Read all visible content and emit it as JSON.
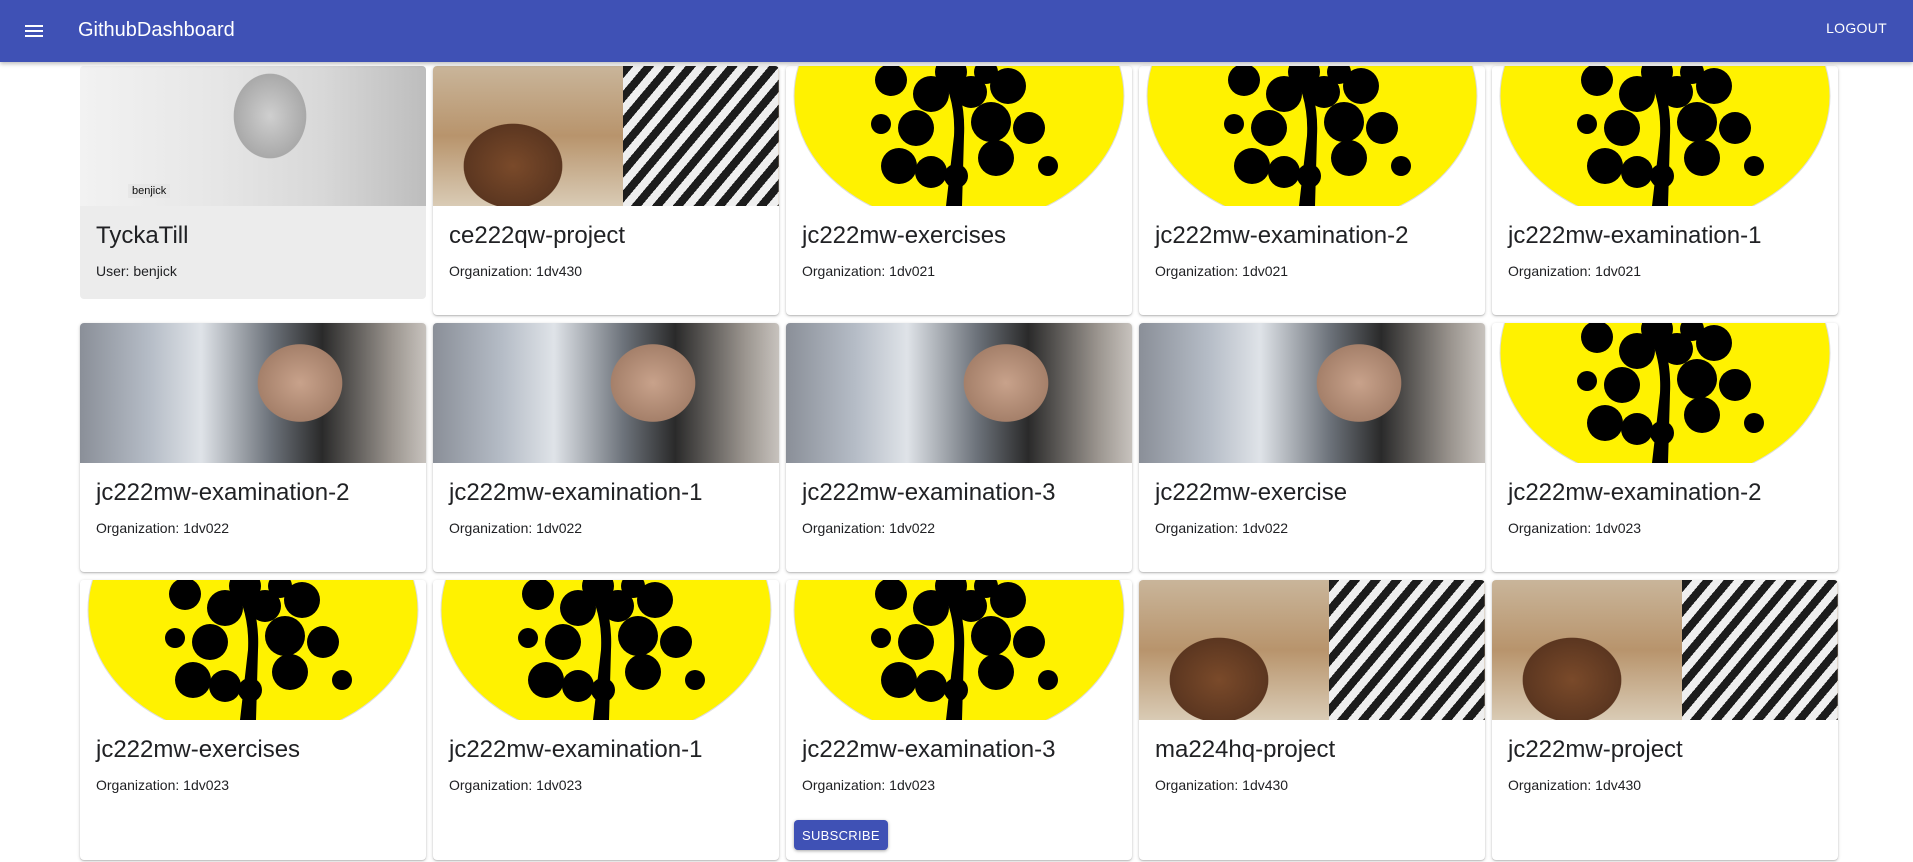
{
  "appbar": {
    "title": "GithubDashboard",
    "logout_label": "LOGOUT",
    "color": "#3f51b5"
  },
  "user_card": {
    "image_label": "benjick",
    "title": "TyckaTill",
    "subtitle": "User: benjick"
  },
  "cards": [
    {
      "title": "ce222qw-project",
      "subtitle": "Organization: 1dv430",
      "image": "desk-photo"
    },
    {
      "title": "jc222mw-exercises",
      "subtitle": "Organization: 1dv021",
      "image": "tree-logo"
    },
    {
      "title": "jc222mw-examination-2",
      "subtitle": "Organization: 1dv021",
      "image": "tree-logo"
    },
    {
      "title": "jc222mw-examination-1",
      "subtitle": "Organization: 1dv021",
      "image": "tree-logo"
    },
    {
      "title": "jc222mw-examination-2",
      "subtitle": "Organization: 1dv022",
      "image": "thinker-photo"
    },
    {
      "title": "jc222mw-examination-1",
      "subtitle": "Organization: 1dv022",
      "image": "thinker-photo"
    },
    {
      "title": "jc222mw-examination-3",
      "subtitle": "Organization: 1dv022",
      "image": "thinker-photo"
    },
    {
      "title": "jc222mw-exercise",
      "subtitle": "Organization: 1dv022",
      "image": "thinker-photo"
    },
    {
      "title": "jc222mw-examination-2",
      "subtitle": "Organization: 1dv023",
      "image": "tree-logo"
    },
    {
      "title": "jc222mw-exercises",
      "subtitle": "Organization: 1dv023",
      "image": "tree-logo"
    },
    {
      "title": "jc222mw-examination-1",
      "subtitle": "Organization: 1dv023",
      "image": "tree-logo"
    },
    {
      "title": "jc222mw-examination-3",
      "subtitle": "Organization: 1dv023",
      "image": "tree-logo",
      "button": "SUBSCRIBE"
    },
    {
      "title": "ma224hq-project",
      "subtitle": "Organization: 1dv430",
      "image": "desk-photo"
    },
    {
      "title": "jc222mw-project",
      "subtitle": "Organization: 1dv430",
      "image": "desk-photo"
    }
  ],
  "icons": {
    "menu": "menu-icon",
    "tree_logo": "tree-logo-icon"
  },
  "colors": {
    "logo_yellow": "#fff200",
    "button": "#3f51b5"
  }
}
